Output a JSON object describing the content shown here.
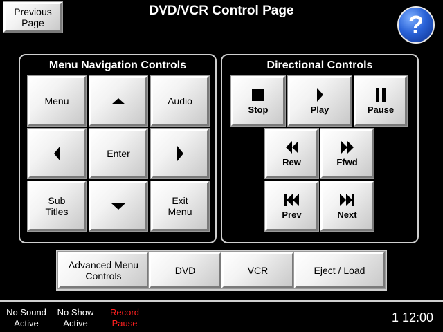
{
  "header": {
    "title": "DVD/VCR Control Page",
    "previous_page_label": "Previous Page",
    "help_label": "?",
    "help_color": "#1f5fd8"
  },
  "menu_nav": {
    "title": "Menu Navigation Controls",
    "menu": "Menu",
    "enter": "Enter",
    "audio": "Audio",
    "sub_titles": "Sub Titles",
    "exit_menu": "Exit Menu",
    "up_icon": "up-arrow-icon",
    "down_icon": "down-arrow-icon",
    "left_icon": "left-arrow-icon",
    "right_icon": "right-arrow-icon"
  },
  "directional": {
    "title": "Directional Controls",
    "stop": "Stop",
    "play": "Play",
    "pause": "Pause",
    "rew": "Rew",
    "ffwd": "Ffwd",
    "prev": "Prev",
    "next": "Next"
  },
  "source_bar": {
    "advanced": "Advanced Menu Controls",
    "dvd": "DVD",
    "vcr": "VCR",
    "eject": "Eject / Load"
  },
  "status": {
    "no_sound": "No Sound Active",
    "no_show": "No Show Active",
    "record_pause": "Record Pause",
    "record_color": "#ff2020",
    "clock": "1 12:00"
  }
}
